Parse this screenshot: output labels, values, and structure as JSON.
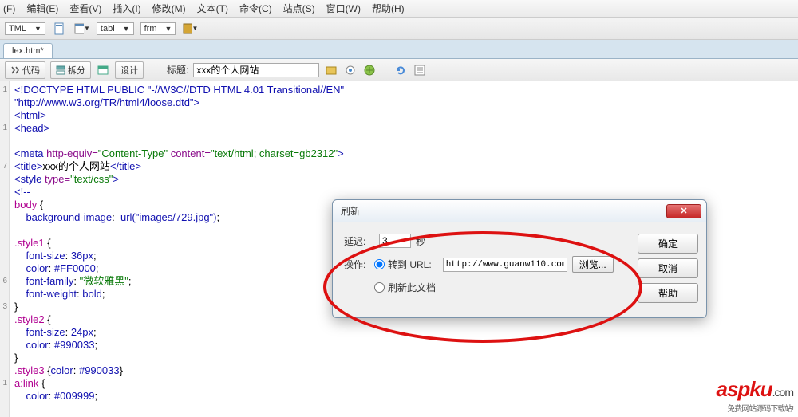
{
  "menubar": [
    "(F)",
    "编辑(E)",
    "查看(V)",
    "插入(I)",
    "修改(M)",
    "文本(T)",
    "命令(C)",
    "站点(S)",
    "窗口(W)",
    "帮助(H)"
  ],
  "toolbar1": {
    "lang": "TML",
    "items": [
      "tabl",
      "frm"
    ]
  },
  "tab": {
    "label": "lex.htm*"
  },
  "viewbar": {
    "code": "代码",
    "split": "拆分",
    "design": "设计",
    "title_label": "标题:",
    "title_value": "xxx的个人网站"
  },
  "code_lines": [
    {
      "n": "1",
      "html": "<span class='tag'>&lt;!DOCTYPE HTML PUBLIC </span><span class='str'>\"-//W3C//DTD HTML 4.01 Transitional//EN\"</span>"
    },
    {
      "n": "",
      "html": "<span class='str'>\"http://www.w3.org/TR/html4/loose.dtd\"</span><span class='tag'>&gt;</span>"
    },
    {
      "n": "",
      "html": "<span class='tag'>&lt;html&gt;</span>"
    },
    {
      "n": "1",
      "html": "<span class='tag'>&lt;head&gt;</span>"
    },
    {
      "n": "",
      "html": ""
    },
    {
      "n": "",
      "html": "<span class='tag'>&lt;meta </span><span class='attr'>http-equiv=</span><span class='val'>\"Content-Type\"</span> <span class='attr'>content=</span><span class='val'>\"text/html; charset=gb2312\"</span><span class='tag'>&gt;</span>"
    },
    {
      "n": "7",
      "html": "<span class='tag'>&lt;title&gt;</span>xxx的个人网站<span class='tag'>&lt;/title&gt;</span>"
    },
    {
      "n": "",
      "html": "<span class='tag'>&lt;style </span><span class='attr'>type=</span><span class='val'>\"text/css\"</span><span class='tag'>&gt;</span>"
    },
    {
      "n": "",
      "html": "<span class='tag'>&lt;!--</span>"
    },
    {
      "n": "",
      "html": "<span class='sel'>body</span> {"
    },
    {
      "n": "",
      "html": "    <span class='prop'>background-image</span>:  <span class='pval'>url(\"images/729.jpg\")</span>;"
    },
    {
      "n": "",
      "html": ""
    },
    {
      "n": "",
      "html": "<span class='sel'>.style1</span> {"
    },
    {
      "n": "",
      "html": "    <span class='prop'>font-size</span>: <span class='pval'>36px</span>;"
    },
    {
      "n": "",
      "html": "    <span class='prop'>color</span>: <span class='pval'>#FF0000</span>;"
    },
    {
      "n": "6",
      "html": "    <span class='prop'>font-family</span>: <span class='val'>\"微软雅黑\"</span>;"
    },
    {
      "n": "",
      "html": "    <span class='prop'>font-weight</span>: <span class='pval'>bold</span>;"
    },
    {
      "n": "3",
      "html": "}"
    },
    {
      "n": "",
      "html": "<span class='sel'>.style2</span> {"
    },
    {
      "n": "",
      "html": "    <span class='prop'>font-size</span>: <span class='pval'>24px</span>;"
    },
    {
      "n": "",
      "html": "    <span class='prop'>color</span>: <span class='pval'>#990033</span>;"
    },
    {
      "n": "",
      "html": "}"
    },
    {
      "n": "",
      "html": "<span class='sel'>.style3</span> {<span class='prop'>color</span>: <span class='pval'>#990033</span>}"
    },
    {
      "n": "1",
      "html": "<span class='sel'>a:link</span> {"
    },
    {
      "n": "",
      "html": "    <span class='prop'>color</span>: <span class='pval'>#009999</span>;"
    }
  ],
  "dialog": {
    "title": "刷新",
    "delay_label": "延迟:",
    "delay_value": "3",
    "seconds": "秒",
    "action_label": "操作:",
    "goto_url_label": "转到 URL:",
    "url_value": "http://www.guanw110.com",
    "browse": "浏览...",
    "refresh_doc": "刷新此文档",
    "ok": "确定",
    "cancel": "取消",
    "help": "帮助"
  },
  "watermark": {
    "brand": "aspku",
    "dot": ".com",
    "sub": "免费网站源码下载站!"
  }
}
